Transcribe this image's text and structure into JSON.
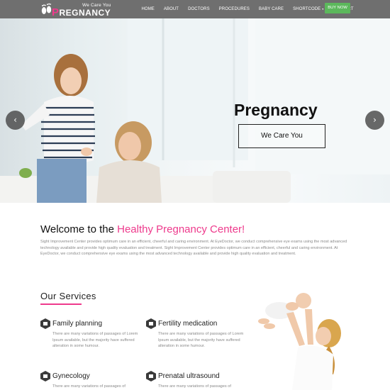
{
  "brand": {
    "tagline": "We Care You",
    "name_initial": "P",
    "name_rest": "REGNANCY",
    "icon": "baby-feet-logo-icon",
    "accent_color": "#ee3a8c"
  },
  "nav": {
    "items": [
      "HOME",
      "ABOUT",
      "DOCTORS",
      "PROCEDURES",
      "BABY CARE",
      "SHORTCODE",
      "CONTACT"
    ],
    "dropdown_caret": "▾",
    "buy_label": "BUY NOW",
    "buy_color": "#5cb85c",
    "bar_color": "#6f6f6f"
  },
  "hero": {
    "title": "Pregnancy",
    "button_label": "We Care You",
    "prev_icon": "‹",
    "next_icon": "›"
  },
  "welcome": {
    "title_plain": "Welcome to the ",
    "title_accent": "Healthy Pregnancy Center!",
    "body": "Sight Improvement Center provides optimum care in an efficient, cheerful and caring environment. At EyeDoctor, we conduct comprehensive eye exams using the most advanced technology available and provide high quality evaluation and treatment. Sight Improvement Center provides optimum care in an efficient, cheerful and caring environment. At EyeDoctor, we conduct comprehensive eye exams using the most advanced technology available and provide high quality evaluation and treatment."
  },
  "services": {
    "heading": "Our Services",
    "items": [
      {
        "name": "Family planning",
        "desc": "There are many variations of passages of Lorem Ipsum available, but the majority have suffered alteration in some humour.",
        "icon": "hexagon-icon"
      },
      {
        "name": "Fertility medication",
        "desc": "There are many variations of passages of Lorem Ipsum available, but the majority have suffered alteration in some humour.",
        "icon": "hexagon-icon"
      },
      {
        "name": "Gynecology",
        "desc": "There are many variations of passages of",
        "icon": "hexagon-icon"
      },
      {
        "name": "Prenatal ultrasound",
        "desc": "There are many variations of passages of",
        "icon": "hexagon-icon"
      }
    ]
  }
}
